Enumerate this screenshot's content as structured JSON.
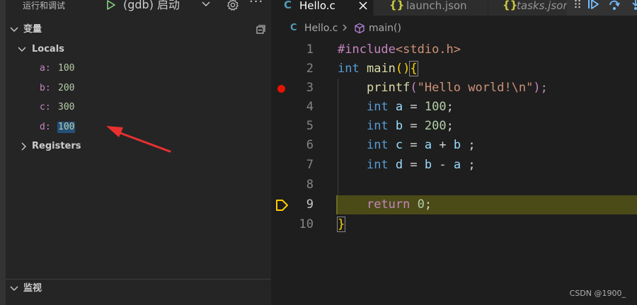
{
  "debug": {
    "title": "运行和调试",
    "config_name": "(gdb) 启动",
    "variables_header": "变量",
    "locals_label": "Locals",
    "registers_label": "Registers",
    "watch_header": "监视",
    "variables": [
      {
        "name": "a:",
        "value": "100"
      },
      {
        "name": "b:",
        "value": "200"
      },
      {
        "name": "c:",
        "value": "300"
      },
      {
        "name": "d:",
        "value": "100"
      }
    ]
  },
  "tabs": [
    {
      "icon": "C",
      "label": "Hello.c"
    },
    {
      "icon": "{}",
      "label": "launch.json"
    },
    {
      "icon": "{}",
      "label": "tasks.json"
    }
  ],
  "breadcrumb": {
    "icon": "C",
    "file": "Hello.c",
    "symbol": "main()"
  },
  "code": {
    "line_numbers": [
      "1",
      "2",
      "3",
      "4",
      "5",
      "6",
      "7",
      "8",
      "9",
      "10"
    ],
    "l1_include": "#include",
    "l1_header": "<stdio.h>",
    "l2_type": "int",
    "l2_fn": "main",
    "l2_parens": "()",
    "l2_brace": "{",
    "l3_fn": "printf",
    "l3_open": "(",
    "l3_str": "\"Hello world!\\n\"",
    "l3_close": ");",
    "l4_type": "int",
    "l4_var": "a",
    "l4_eq": " = ",
    "l4_num": "100",
    "l4_end": ";",
    "l5_type": "int",
    "l5_var": "b",
    "l5_eq": " = ",
    "l5_num": "200",
    "l5_end": ";",
    "l6_type": "int",
    "l6_var": "c",
    "l6_eq": " = ",
    "l6_a": "a",
    "l6_op": " + ",
    "l6_b": "b",
    "l6_end": " ;",
    "l7_type": "int",
    "l7_var": "d",
    "l7_eq": " = ",
    "l7_b": "b",
    "l7_op": " - ",
    "l7_a": "a",
    "l7_end": " ;",
    "l9_kw": "return",
    "l9_num": "0",
    "l9_end": ";",
    "l10_brace": "}"
  },
  "watermark": "CSDN @1900_",
  "colors": {
    "breakpoint": "#e51400",
    "exec_line": "#4b4b18",
    "annotation_arrow": "#e8312f"
  }
}
